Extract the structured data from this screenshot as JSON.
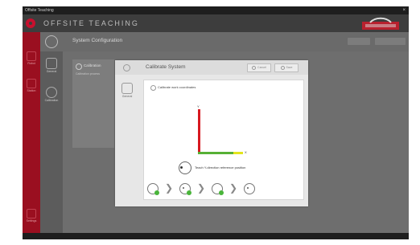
{
  "window": {
    "title": "Offsite Teaching",
    "close": "×"
  },
  "header": {
    "brand": "OFFSITE TEACHING"
  },
  "subheader": {
    "title": "System Configuration"
  },
  "red_nav": [
    {
      "label": "Robot"
    },
    {
      "label": "Station"
    },
    {
      "label": "Settings"
    }
  ],
  "left_nav": [
    {
      "label": "General"
    },
    {
      "label": "Calibration"
    }
  ],
  "calibration_panel": {
    "title": "Calibration",
    "subtitle": "Calibration process"
  },
  "dialog": {
    "title": "Calibrate System",
    "buttons": [
      {
        "label": "Cancel"
      },
      {
        "label": "Save"
      }
    ],
    "nav_label": "General",
    "section_title": "Calibrate work coordinates",
    "y_label": "Y",
    "x_label": "X",
    "teach_text": "Teach Y-direction reference position"
  },
  "colors": {
    "accent_red": "#9a0f20",
    "y_axis": "#d71920",
    "x_axis": "#56b035",
    "x_tip": "#e3e51c",
    "step_done": "#49b53a"
  }
}
